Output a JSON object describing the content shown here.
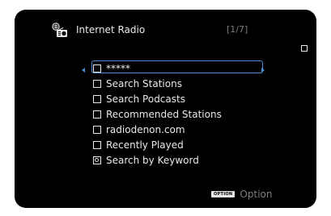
{
  "header": {
    "title": "Internet Radio",
    "page_indicator": "[1/7]",
    "app_icon": "internet-radio-icon"
  },
  "menu": {
    "selected_index": 0,
    "items": [
      {
        "label": "*****",
        "icon": "box"
      },
      {
        "label": "Search Stations",
        "icon": "box"
      },
      {
        "label": "Search Podcasts",
        "icon": "box"
      },
      {
        "label": "Recommended Stations",
        "icon": "box"
      },
      {
        "label": "radiodenon.com",
        "icon": "box"
      },
      {
        "label": "Recently Played",
        "icon": "box"
      },
      {
        "label": "Search by Keyword",
        "icon": "search"
      }
    ]
  },
  "footer": {
    "option_badge": "OPTION",
    "option_label": "Option"
  },
  "colors": {
    "background": "#000000",
    "text": "#e8e8e8",
    "dim_text": "#7d7d7d",
    "selection": "#4a8fd6"
  }
}
